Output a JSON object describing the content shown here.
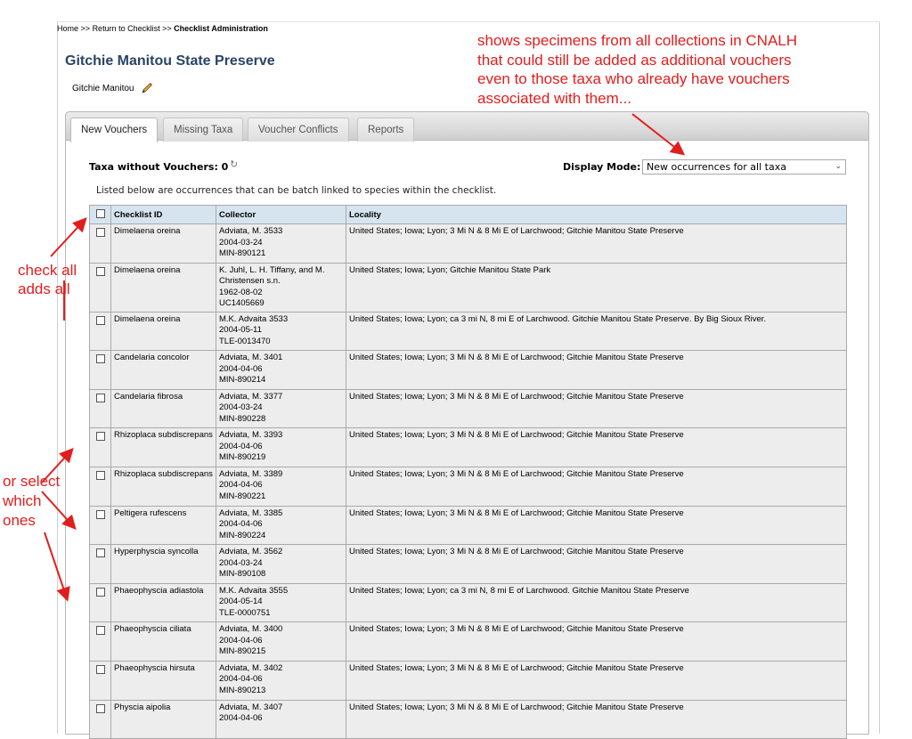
{
  "breadcrumb": {
    "home": "Home",
    "sep1": ">>",
    "return": "Return to Checklist",
    "sep2": ">>",
    "current": "Checklist Administration"
  },
  "page_title": "Gitchie Manitou State Preserve",
  "subtitle": "Gitchie Manitou",
  "tabs": [
    {
      "label": "New Vouchers"
    },
    {
      "label": "Missing Taxa"
    },
    {
      "label": "Voucher Conflicts"
    },
    {
      "label": "Reports"
    }
  ],
  "taxa_without_vouchers": "Taxa without Vouchers: 0",
  "display_mode": {
    "label": "Display Mode:",
    "selected": "New occurrences for all taxa"
  },
  "listed_text": "Listed below are occurrences that can be batch linked to species within the checklist.",
  "table": {
    "headers": [
      "Checklist ID",
      "Collector",
      "Locality"
    ],
    "rows": [
      {
        "id": "Dimelaena oreina",
        "collector": [
          "Adviata, M. 3533",
          "2004-03-24",
          "MIN-890121"
        ],
        "locality": "United States; Iowa; Lyon; 3 Mi N & 8 Mi E of Larchwood; Gitchie Manitou State Preserve"
      },
      {
        "id": "Dimelaena oreina",
        "collector": [
          "K. Juhl, L. H. Tiffany, and M.",
          "Christensen s.n.",
          "1962-08-02",
          "UC1405669"
        ],
        "locality": "United States; Iowa; Lyon; Gitchie Manitou State Park"
      },
      {
        "id": "Dimelaena oreina",
        "collector": [
          "M.K. Advaita 3533",
          "2004-05-11",
          "TLE-0013470"
        ],
        "locality": "United States; Iowa; Lyon; ca 3 mi N, 8 mi E of Larchwood. Gitchie Manitou State Preserve. By Big Sioux River."
      },
      {
        "id": "Candelaria concolor",
        "collector": [
          "Adviata, M. 3401",
          "2004-04-06",
          "MIN-890214"
        ],
        "locality": "United States; Iowa; Lyon; 3 Mi N & 8 Mi E of Larchwood; Gitchie Manitou State Preserve"
      },
      {
        "id": "Candelaria fibrosa",
        "collector": [
          "Adviata, M. 3377",
          "2004-03-24",
          "MIN-890228"
        ],
        "locality": "United States; Iowa; Lyon; 3 Mi N & 8 Mi E of Larchwood; Gitchie Manitou State Preserve"
      },
      {
        "id": "Rhizoplaca subdiscrepans",
        "collector": [
          "Adviata, M. 3393",
          "2004-04-06",
          "MIN-890219"
        ],
        "locality": "United States; Iowa; Lyon; 3 Mi N & 8 Mi E of Larchwood; Gitchie Manitou State Preserve"
      },
      {
        "id": "Rhizoplaca subdiscrepans",
        "collector": [
          "Adviata, M. 3389",
          "2004-04-06",
          "MIN-890221"
        ],
        "locality": "United States; Iowa; Lyon; 3 Mi N & 8 Mi E of Larchwood; Gitchie Manitou State Preserve"
      },
      {
        "id": "Peltigera rufescens",
        "collector": [
          "Adviata, M. 3385",
          "2004-04-06",
          "MIN-890224"
        ],
        "locality": "United States; Iowa; Lyon; 3 Mi N & 8 Mi E of Larchwood; Gitchie Manitou State Preserve"
      },
      {
        "id": "Hyperphyscia syncolla",
        "collector": [
          "Adviata, M. 3562",
          "2004-03-24",
          "MIN-890108"
        ],
        "locality": "United States; Iowa; Lyon; 3 Mi N & 8 Mi E of Larchwood; Gitchie Manitou State Preserve"
      },
      {
        "id": "Phaeophyscia adiastola",
        "collector": [
          "M.K. Advaita 3555",
          "2004-05-14",
          "TLE-0000751"
        ],
        "locality": "United States; Iowa; Lyon; ca 3 mi N, 8 mi E of Larchwood. Gitchie Manitou State Preserve"
      },
      {
        "id": "Phaeophyscia ciliata",
        "collector": [
          "Adviata, M. 3400",
          "2004-04-06",
          "MIN-890215"
        ],
        "locality": "United States; Iowa; Lyon; 3 Mi N & 8 Mi E of Larchwood; Gitchie Manitou State Preserve"
      },
      {
        "id": "Phaeophyscia hirsuta",
        "collector": [
          "Adviata, M. 3402",
          "2004-04-06",
          "MIN-890213"
        ],
        "locality": "United States; Iowa; Lyon; 3 Mi N & 8 Mi E of Larchwood; Gitchie Manitou State Preserve"
      },
      {
        "id": "Physcia aipolia",
        "collector": [
          "Adviata, M. 3407",
          "2004-04-06",
          ""
        ],
        "locality": "United States; Iowa; Lyon; 3 Mi N & 8 Mi E of Larchwood; Gitchie Manitou State Preserve"
      }
    ]
  },
  "annotations": {
    "top": [
      "shows specimens from all collections in CNALH",
      "that could still be added as additional vouchers",
      "even to those taxa who already have vouchers",
      "associated with them..."
    ],
    "left1": [
      "check all",
      "adds all"
    ],
    "left2": [
      "or select",
      "which",
      "ones"
    ]
  },
  "colors": {
    "title": "#2a4466",
    "header_bg": "#d6e4f0",
    "row_bg": "#ededed",
    "annotation": "#e31d1d"
  },
  "icons": {
    "edit": "pencil-icon",
    "refresh": "refresh-icon",
    "dropdown": "chevron-down-icon"
  }
}
